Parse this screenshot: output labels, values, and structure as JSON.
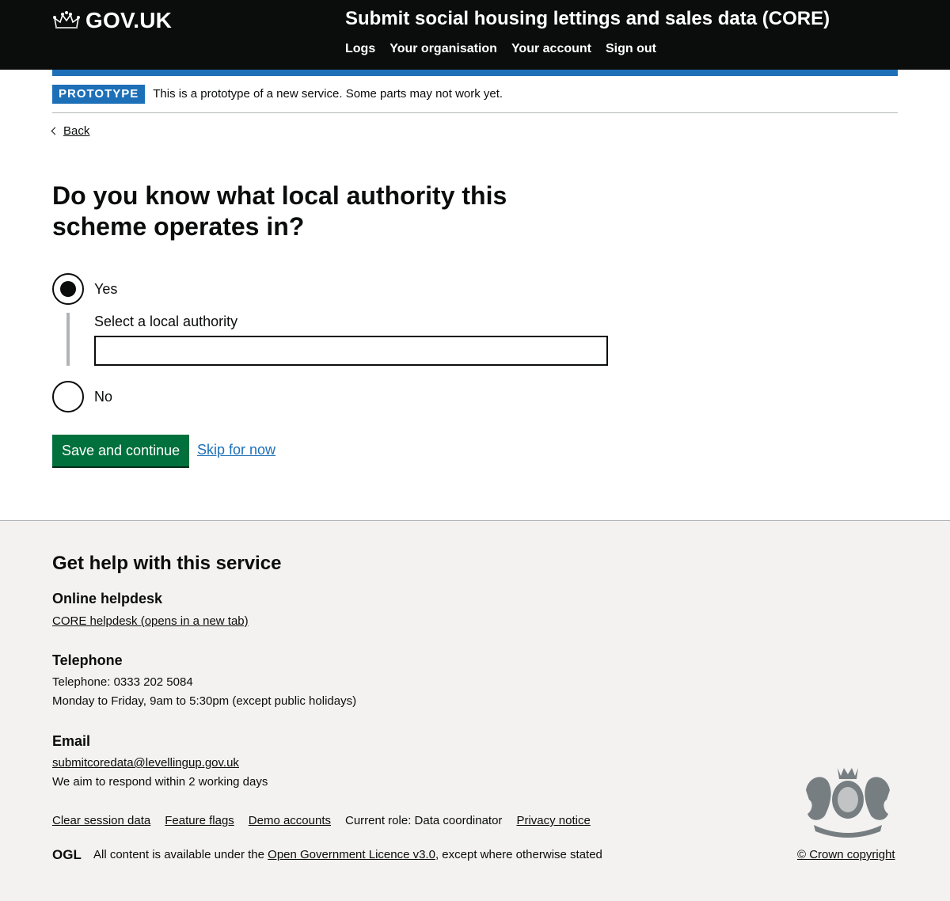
{
  "header": {
    "logo_text": "GOV.UK",
    "service_name": "Submit social housing lettings and sales data (CORE)",
    "nav": [
      {
        "label": "Logs"
      },
      {
        "label": "Your organisation"
      },
      {
        "label": "Your account"
      },
      {
        "label": "Sign out"
      }
    ]
  },
  "phase_banner": {
    "tag": "PROTOTYPE",
    "text": "This is a prototype of a new service. Some parts may not work yet."
  },
  "back_link": "Back",
  "question": {
    "title": "Do you know what local authority this scheme operates in?",
    "options": [
      {
        "label": "Yes",
        "selected": true
      },
      {
        "label": "No",
        "selected": false
      }
    ],
    "conditional_label": "Select a local authority",
    "conditional_value": ""
  },
  "actions": {
    "save_label": "Save and continue",
    "skip_label": "Skip for now"
  },
  "footer": {
    "heading": "Get help with this service",
    "helpdesk": {
      "heading": "Online helpdesk",
      "link": "CORE helpdesk (opens in a new tab)"
    },
    "telephone": {
      "heading": "Telephone",
      "number": "Telephone: 0333 202 5084",
      "hours": "Monday to Friday, 9am to 5:30pm (except public holidays)"
    },
    "email": {
      "heading": "Email",
      "address": "submitcoredata@levellingup.gov.uk",
      "note": "We aim to respond within 2 working days"
    },
    "meta_links": [
      {
        "label": "Clear session data"
      },
      {
        "label": "Feature flags"
      },
      {
        "label": "Demo accounts"
      }
    ],
    "current_role": "Current role: Data coordinator",
    "privacy": "Privacy notice",
    "licence_prefix": "All content is available under the",
    "licence_link": "Open Government Licence v3.0",
    "licence_suffix": ", except where otherwise stated",
    "ogl_text": "OGL",
    "copyright": "© Crown copyright"
  },
  "colors": {
    "header_bg": "#0b0c0c",
    "brand_blue": "#1d70b8",
    "button_green": "#00703c",
    "footer_bg": "#f3f2f1"
  }
}
